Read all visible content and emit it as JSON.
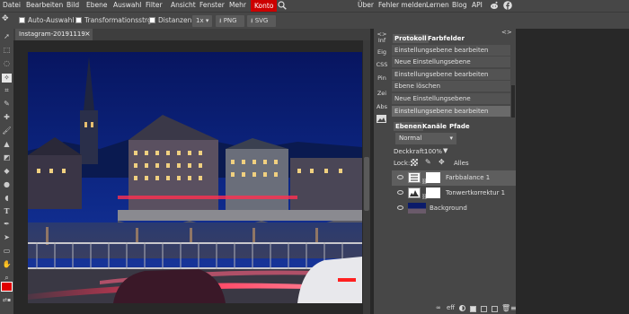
{
  "menu": {
    "items": [
      "Datei",
      "Bearbeiten",
      "Bild",
      "Ebene",
      "Auswahl",
      "Filter",
      "Ansicht",
      "Fenster",
      "Mehr"
    ],
    "konto": "Konto",
    "right": [
      "Über",
      "Fehler melden",
      "Lernen",
      "Blog",
      "API"
    ]
  },
  "options": {
    "auto_select": "Auto-Auswahl",
    "transform": "Transformationsstrg.",
    "distances": "Distanzen",
    "zoom": "1x",
    "png": "PNG",
    "svg": "SVG"
  },
  "document": {
    "tab_title": "Instagram-20191119",
    "close": "×"
  },
  "side_tabs": [
    "Inf",
    "Eig",
    "CSS",
    "Pin",
    "Zei",
    "Abs"
  ],
  "history": {
    "tabs": [
      "Protokoll",
      "Farbfelder"
    ],
    "entries": [
      "Einstellungsebene bearbeiten",
      "Neue Einstellungsebene",
      "Einstellungsebene bearbeiten",
      "Ebene löschen",
      "Neue Einstellungsebene",
      "Einstellungsebene bearbeiten"
    ]
  },
  "layers_panel": {
    "tabs": [
      "Ebenen",
      "Kanäle",
      "Pfade"
    ],
    "blend_mode": "Normal",
    "opacity_label": "Deckkraft:",
    "opacity_value": "100%",
    "lock_label": "Lock:",
    "lock_all": "Alles",
    "layers": [
      {
        "name": "Farbbalance 1"
      },
      {
        "name": "Tonwertkorrektur 1"
      },
      {
        "name": "Background"
      }
    ],
    "bottom_icons": [
      "eff"
    ]
  },
  "colors": {
    "foreground": "#e00000",
    "background": "#ffffff",
    "accent": "#cc0000"
  }
}
